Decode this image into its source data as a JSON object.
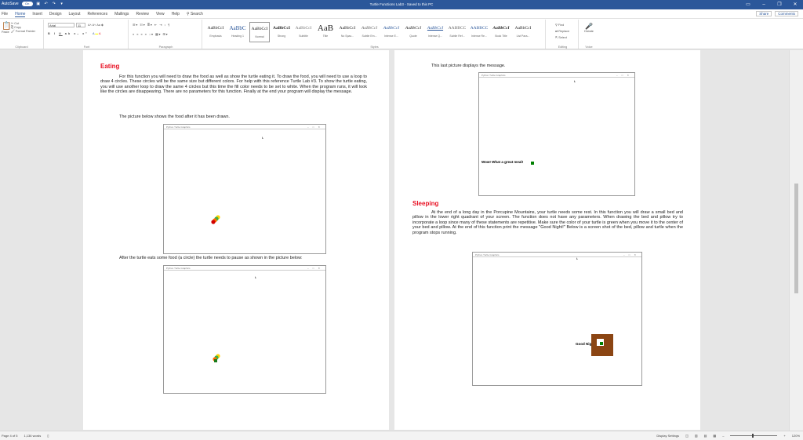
{
  "titlebar": {
    "autosave": "AutoSave",
    "autosave_state": "On",
    "title": "Turtle Functions Lab3  -  Saved to this PC"
  },
  "tabs": [
    "File",
    "Home",
    "Insert",
    "Design",
    "Layout",
    "References",
    "Mailings",
    "Review",
    "View",
    "Help"
  ],
  "search": "Search",
  "share": "Share",
  "comments": "Comments",
  "ribbon": {
    "clipboard": {
      "paste": "Paste",
      "cut": "Cut",
      "copy": "Copy",
      "format_painter": "Format Painter",
      "label": "Clipboard"
    },
    "font": {
      "name": "Arial",
      "size": "11",
      "label": "Font"
    },
    "paragraph": {
      "label": "Paragraph"
    },
    "styles": {
      "label": "Styles",
      "items": [
        {
          "preview": "AaBbCcI",
          "name": "Emphasis"
        },
        {
          "preview": "AaBbC",
          "name": "Heading 1"
        },
        {
          "preview": "AaBbCcI",
          "name": "Normal"
        },
        {
          "preview": "AaBbCcI",
          "name": "Strong"
        },
        {
          "preview": "AaBbCcI",
          "name": "Subtitle"
        },
        {
          "preview": "AaB",
          "name": "Title"
        },
        {
          "preview": "AaBbCcI",
          "name": "No Spac..."
        },
        {
          "preview": "AaBbCcI",
          "name": "Subtle Em..."
        },
        {
          "preview": "AaBbCcI",
          "name": "Intense E..."
        },
        {
          "preview": "AaBbCcI",
          "name": "Quote"
        },
        {
          "preview": "AaBbCcI",
          "name": "Intense Q..."
        },
        {
          "preview": "AABBCC",
          "name": "Subtle Ref..."
        },
        {
          "preview": "AABBCC",
          "name": "Intense Re..."
        },
        {
          "preview": "AaBbCcI",
          "name": "Book Title"
        },
        {
          "preview": "AaBbCcI",
          "name": "List Para..."
        }
      ]
    },
    "editing": {
      "find": "Find",
      "replace": "Replace",
      "select": "Select",
      "label": "Editing"
    },
    "voice": {
      "dictate": "Dictate",
      "label": "Voice"
    }
  },
  "doc": {
    "eating": {
      "heading": "Eating",
      "para": "For this function you will need to draw the food as well as show the turtle eating it.  To draw the food, you will need to use a loop to draw 4 circles.  These circles will be the same size but different colors.  For help with this reference Turtle Lab #3.  To show the turtle eating, you will use another loop to draw the same 4 circles but this time the fill color needs to be set to white.  When the program runs, it will look like the circles are disappearing.  There are no parameters for this function.  Finally at the end your program will display the message.",
      "pic1_caption": "The picture below shows the food after it has been drawn.",
      "pic2_caption": "After the turtle eats some food (a circle) the turtle needs to pause as shown in the picture below:"
    },
    "right": {
      "last_caption": "This last picture displays the message.",
      "message": "Wow! What a great meal!",
      "sleep_heading": "Sleeping",
      "sleep_para": "At the end of a long day in the Porcupine Mountains, your turtle needs some rest.  In this function you will draw a small bed and pillow in the lower right quadrant of your screen.  The function does not have any parameters.  When drawing the bed and pillow try to incorporate a loop since many of these statements are repetitive.  Make sure the color of your turtle is green when you move it to the center of your bed and pillow.  At the end of this function print the message \"Good Night!\"  Below is a screen shot of the bed, pillow and turtle when the program stops running.",
      "good_night": "Good Night!"
    },
    "turtle_window_title": "Python Turtle Graphics"
  },
  "colors": {
    "accent": "#2b579a",
    "heading": "#e81123",
    "bed": "#8b4513",
    "turtle": "#008000"
  },
  "status": {
    "page": "Page 4 of 5",
    "words": "1,136 words",
    "focus": "Display Settings",
    "zoom": "120%"
  }
}
